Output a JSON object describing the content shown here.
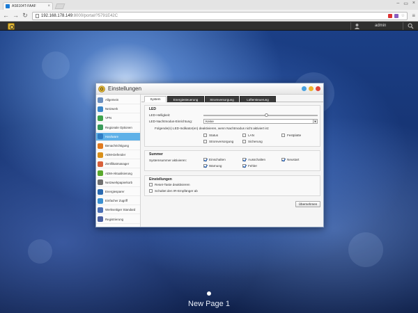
{
  "browser": {
    "tab_title": "AS6104T-FAAF",
    "url_host": "192.168.178.149",
    "url_path": ":8000/portal/?5791E42C"
  },
  "adm": {
    "username": "admin"
  },
  "desktop": {
    "page_label": "New Page 1"
  },
  "window": {
    "title": "Einstellungen",
    "sidebar": [
      {
        "label": "Allgemein",
        "icon": "general-icon",
        "color": "#6a8fbf"
      },
      {
        "label": "Netzwerk",
        "icon": "network-icon",
        "color": "#3a86c8"
      },
      {
        "label": "VPN",
        "icon": "vpn-icon",
        "color": "#3fa34d"
      },
      {
        "label": "Regionale Optionen",
        "icon": "region-icon",
        "color": "#3a9b5a"
      },
      {
        "label": "Hardware",
        "icon": "hardware-icon",
        "color": "#2f7dc4"
      },
      {
        "label": "Benachrichtigung",
        "icon": "notification-icon",
        "color": "#e07a1f"
      },
      {
        "label": "ADM-Defender",
        "icon": "defender-icon",
        "color": "#d9901a"
      },
      {
        "label": "Zertifikatmanager",
        "icon": "certificate-icon",
        "color": "#d8603a"
      },
      {
        "label": "ADM-Aktualisierung",
        "icon": "update-icon",
        "color": "#5aa82d"
      },
      {
        "label": "Netzwerkpapierkorb",
        "icon": "recycle-bin-icon",
        "color": "#707070"
      },
      {
        "label": "Energiesparer",
        "icon": "energy-icon",
        "color": "#2a6ab0"
      },
      {
        "label": "Einfacher Zugriff",
        "icon": "easy-access-icon",
        "color": "#3a8fd0"
      },
      {
        "label": "Werkseitiger Standard",
        "icon": "factory-default-icon",
        "color": "#4b6fb5"
      },
      {
        "label": "Registrierung",
        "icon": "registration-icon",
        "color": "#4a5fa0"
      }
    ],
    "active_sidebar_index": 4,
    "tabs": [
      {
        "label": "System"
      },
      {
        "label": "Energiesteuerung"
      },
      {
        "label": "Stromversorgung"
      },
      {
        "label": "Lüftersteuerung"
      }
    ],
    "led": {
      "legend": "LED",
      "brightness_label": "LED-Helligkeit:",
      "brightness_fraction": 0.55,
      "night_mode_label": "LED-Nachtmodus-Einrichtung:",
      "night_mode_value": "Keine",
      "night_mode_note": "Folgende(n) LED-Indikator(en) deaktivieren, wenn Nachtmodus nicht aktiviert ist:",
      "indicators": [
        {
          "label": "Status",
          "checked": false
        },
        {
          "label": "LAN",
          "checked": false
        },
        {
          "label": "Festplatte",
          "checked": false
        },
        {
          "label": "Stromversorgung",
          "checked": false
        },
        {
          "label": "Sicherung",
          "checked": false
        }
      ]
    },
    "buzzer": {
      "legend": "Summer",
      "label": "Systemsummer aktivieren:",
      "options": [
        {
          "label": "Einschalten",
          "checked": true
        },
        {
          "label": "Ausschalten",
          "checked": true
        },
        {
          "label": "Neustart",
          "checked": true
        },
        {
          "label": "Warnung",
          "checked": true
        },
        {
          "label": "Fehler",
          "checked": true
        }
      ]
    },
    "settings": {
      "legend": "Einstellungen",
      "options": [
        {
          "label": "Reset-Taste deaktivieren",
          "checked": false
        },
        {
          "label": "Schaltet den IR-Empfänger ab",
          "checked": false
        }
      ]
    },
    "apply_label": "Übernehmen"
  }
}
